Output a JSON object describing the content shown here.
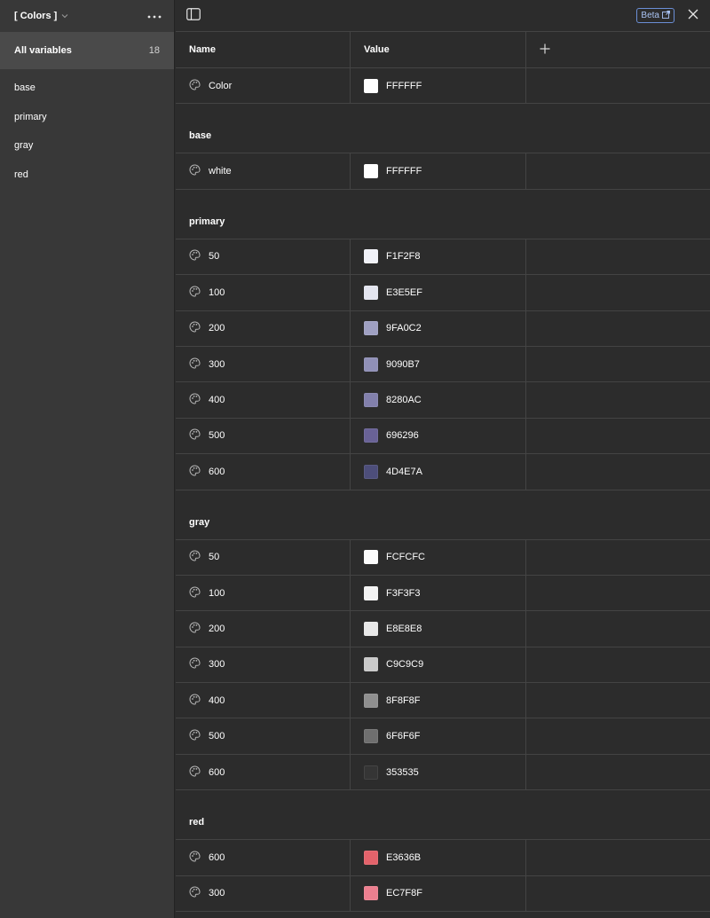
{
  "sidebar": {
    "collection_name": "[ Colors ]",
    "all_variables": {
      "label": "All variables",
      "count": "18"
    },
    "groups": [
      "base",
      "primary",
      "gray",
      "red"
    ]
  },
  "topbar": {
    "beta_label": "Beta"
  },
  "table": {
    "headers": {
      "name": "Name",
      "value": "Value"
    },
    "ungrouped": [
      {
        "name": "Color",
        "value": "FFFFFF",
        "color": "#FFFFFF"
      }
    ],
    "groups": [
      {
        "title": "base",
        "rows": [
          {
            "name": "white",
            "value": "FFFFFF",
            "color": "#FFFFFF"
          }
        ]
      },
      {
        "title": "primary",
        "rows": [
          {
            "name": "50",
            "value": "F1F2F8",
            "color": "#F1F2F8"
          },
          {
            "name": "100",
            "value": "E3E5EF",
            "color": "#E3E5EF"
          },
          {
            "name": "200",
            "value": "9FA0C2",
            "color": "#9FA0C2"
          },
          {
            "name": "300",
            "value": "9090B7",
            "color": "#9090B7"
          },
          {
            "name": "400",
            "value": "8280AC",
            "color": "#8280AC"
          },
          {
            "name": "500",
            "value": "696296",
            "color": "#696296"
          },
          {
            "name": "600",
            "value": "4D4E7A",
            "color": "#4D4E7A"
          }
        ]
      },
      {
        "title": "gray",
        "rows": [
          {
            "name": "50",
            "value": "FCFCFC",
            "color": "#FCFCFC"
          },
          {
            "name": "100",
            "value": "F3F3F3",
            "color": "#F3F3F3"
          },
          {
            "name": "200",
            "value": "E8E8E8",
            "color": "#E8E8E8"
          },
          {
            "name": "300",
            "value": "C9C9C9",
            "color": "#C9C9C9"
          },
          {
            "name": "400",
            "value": "8F8F8F",
            "color": "#8F8F8F"
          },
          {
            "name": "500",
            "value": "6F6F6F",
            "color": "#6F6F6F"
          },
          {
            "name": "600",
            "value": "353535",
            "color": "#353535"
          }
        ]
      },
      {
        "title": "red",
        "rows": [
          {
            "name": "600",
            "value": "E3636B",
            "color": "#E3636B"
          },
          {
            "name": "300",
            "value": "EC7F8F",
            "color": "#EC7F8F"
          }
        ]
      }
    ]
  },
  "icons": {
    "collection_chevron": "chevron-down-icon",
    "more": "more-horizontal-icon",
    "sidebar_toggle": "sidebar-toggle-icon",
    "external_link": "external-link-icon",
    "close": "close-icon",
    "add_column": "plus-icon",
    "variable_type": "palette-icon"
  },
  "colors": {
    "panel_bg": "#2c2c2c",
    "sidebar_bg": "#383838",
    "selected_bg": "#4a4a4a",
    "divider": "#444444",
    "beta_accent": "#6b8fd6"
  }
}
